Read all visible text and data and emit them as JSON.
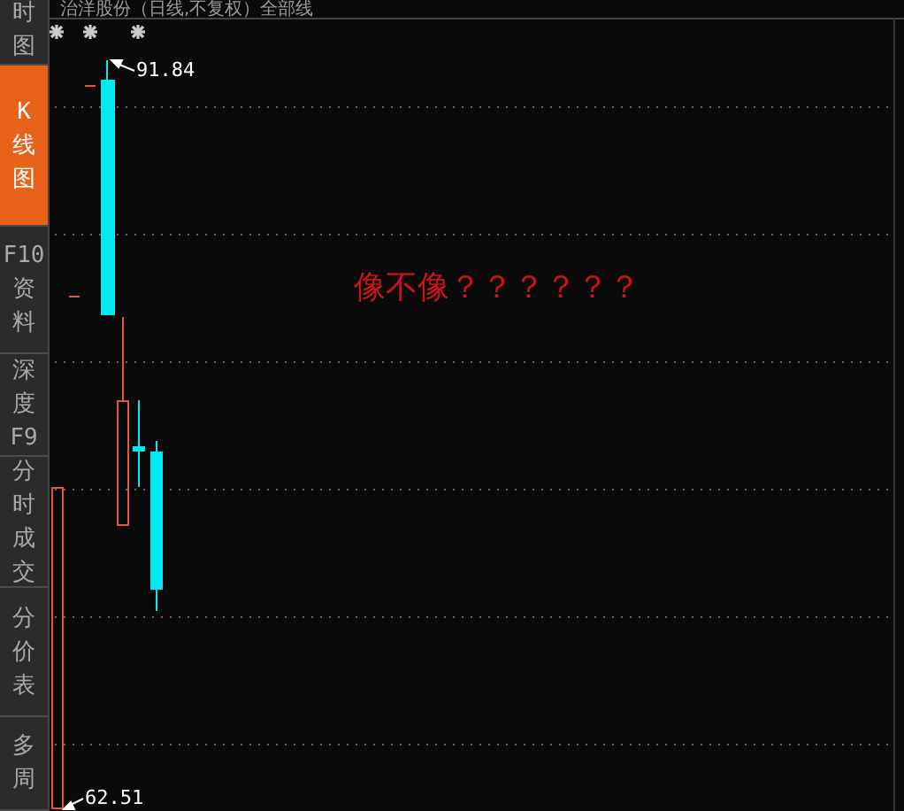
{
  "sidebar": {
    "tabs": [
      {
        "lines": [
          "时",
          "图"
        ],
        "selected": false
      },
      {
        "lines": [
          "K",
          "线",
          "图"
        ],
        "selected": true
      },
      {
        "lines": [
          "F10",
          "资",
          "料"
        ],
        "selected": false
      },
      {
        "lines": [
          "深",
          "度",
          "F9"
        ],
        "selected": false
      },
      {
        "lines": [
          "分",
          "时",
          "成",
          "交"
        ],
        "selected": false
      },
      {
        "lines": [
          "分",
          "价",
          "表"
        ],
        "selected": false
      },
      {
        "lines": [
          "多",
          "周"
        ],
        "selected": false
      }
    ]
  },
  "chart": {
    "title": "治洋股份（日线,不复权）全部线",
    "high_label": "91.84",
    "low_label": "62.51",
    "annotation": "像不像？？？？？？"
  }
}
